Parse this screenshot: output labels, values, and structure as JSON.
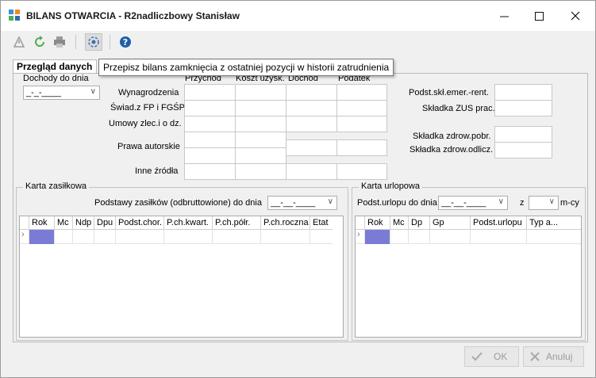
{
  "window": {
    "title": "BILANS OTWARCIA - R2nadliczbowy Stanisław"
  },
  "toolbar": {
    "tooltip": "Przepisz bilans zamknięcia z ostatniej pozycji w historii zatrudnienia"
  },
  "tab": {
    "label": "Przegląd danych"
  },
  "main": {
    "dochody_label": "Dochody do dnia",
    "dochody_date": "_-_-____",
    "col_headers": [
      "Przychód",
      "Koszt uzysk.",
      "Dochód",
      "Podatek"
    ],
    "rows": [
      "Wynagrodzenia",
      "Świad.z FP i FGŚP",
      "Umowy zlec.i o dz.",
      "Prawa autorskie",
      "Inne źródła"
    ],
    "right_labels": [
      "Podst.skł.emer.-rent.",
      "Składka ZUS prac.",
      "Składka zdrow.pobr.",
      "Składka zdrow.odlicz."
    ]
  },
  "karta_zasilkowa": {
    "title": "Karta zasiłkowa",
    "podstawy_label": "Podstawy zasiłków (odbruttowione) do dnia",
    "podstawy_date": "__-__-____",
    "columns": [
      "Rok",
      "Mc",
      "Ndp",
      "Dpu",
      "Podst.chor.",
      "P.ch.kwart.",
      "P.ch.półr.",
      "P.ch.roczna",
      "Etat"
    ]
  },
  "karta_urlopowa": {
    "title": "Karta urlopowa",
    "podst_label": "Podst.urlopu do dnia",
    "podst_date": "__-__-____",
    "z_label": "z",
    "mcy_label": "m-cy",
    "columns": [
      "Rok",
      "Mc",
      "Dp",
      "Gp",
      "Podst.urlopu",
      "Typ a..."
    ]
  },
  "footer": {
    "ok": "OK",
    "cancel": "Anuluj"
  }
}
